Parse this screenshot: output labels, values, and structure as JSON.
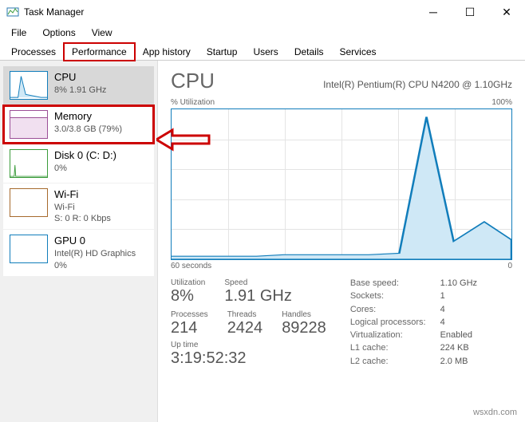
{
  "window": {
    "title": "Task Manager"
  },
  "menu": {
    "file": "File",
    "options": "Options",
    "view": "View"
  },
  "tabs": {
    "processes": "Processes",
    "performance": "Performance",
    "app_history": "App history",
    "startup": "Startup",
    "users": "Users",
    "details": "Details",
    "services": "Services"
  },
  "sidebar": {
    "cpu": {
      "title": "CPU",
      "sub": "8% 1.91 GHz"
    },
    "memory": {
      "title": "Memory",
      "sub": "3.0/3.8 GB (79%)"
    },
    "disk": {
      "title": "Disk 0 (C: D:)",
      "sub": "0%"
    },
    "wifi": {
      "title": "Wi-Fi",
      "sub1": "Wi-Fi",
      "sub2": "S: 0 R: 0 Kbps"
    },
    "gpu": {
      "title": "GPU 0",
      "sub1": "Intel(R) HD Graphics",
      "sub2": "0%"
    }
  },
  "main": {
    "title": "CPU",
    "model": "Intel(R) Pentium(R) CPU N4200 @ 1.10GHz",
    "chart_left": "% Utilization",
    "chart_right": "100%",
    "chart_time_left": "60 seconds",
    "chart_time_right": "0",
    "stats": {
      "utilization_label": "Utilization",
      "utilization": "8%",
      "speed_label": "Speed",
      "speed": "1.91 GHz",
      "processes_label": "Processes",
      "processes": "214",
      "threads_label": "Threads",
      "threads": "2424",
      "handles_label": "Handles",
      "handles": "89228",
      "uptime_label": "Up time",
      "uptime": "3:19:52:32"
    },
    "right_stats": {
      "base_speed_k": "Base speed:",
      "base_speed_v": "1.10 GHz",
      "sockets_k": "Sockets:",
      "sockets_v": "1",
      "cores_k": "Cores:",
      "cores_v": "4",
      "logical_k": "Logical processors:",
      "logical_v": "4",
      "virt_k": "Virtualization:",
      "virt_v": "Enabled",
      "l1_k": "L1 cache:",
      "l1_v": "224 KB",
      "l2_k": "L2 cache:",
      "l2_v": "2.0 MB"
    }
  },
  "chart_data": {
    "type": "line",
    "title": "% Utilization",
    "xlabel": "60 seconds → 0",
    "ylabel": "% Utilization",
    "ylim": [
      0,
      100
    ],
    "x": [
      0,
      5,
      10,
      15,
      20,
      25,
      30,
      35,
      40,
      45,
      50,
      55,
      60
    ],
    "values": [
      2,
      2,
      2,
      2,
      2,
      3,
      3,
      3,
      4,
      95,
      12,
      25,
      13
    ]
  },
  "watermark": "wsxdn.com"
}
